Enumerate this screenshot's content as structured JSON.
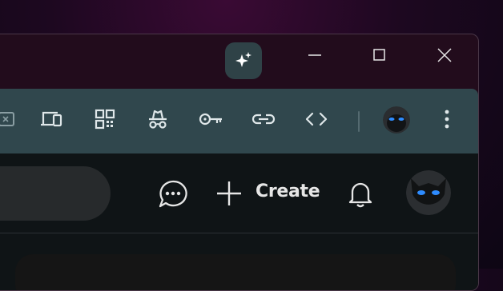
{
  "window": {
    "titlebar": {
      "copilot_button": "copilot-sparkle-icon",
      "controls": [
        "minimize",
        "maximize",
        "close"
      ]
    },
    "toolbar": {
      "icons": [
        "screenshot-icon",
        "devices-icon",
        "qr-code-icon",
        "incognito-icon",
        "key-icon",
        "link-icon",
        "code-icon",
        "profile-avatar",
        "more-options-icon"
      ]
    }
  },
  "header": {
    "search": {
      "placeholder": ""
    },
    "create_label": "Create",
    "icons": [
      "chat-bubble-icon",
      "plus-icon",
      "bell-icon",
      "avatar"
    ]
  },
  "colors": {
    "toolbar": "#30474d",
    "content": "#0f1416",
    "copilot_button": "#2f4247",
    "avatar_eye": "#2e8cff"
  }
}
